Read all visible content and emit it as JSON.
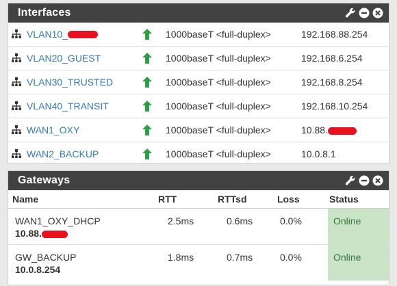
{
  "interfaces": {
    "title": "Interfaces",
    "rows": [
      {
        "name": "VLAN10_",
        "redacted": true,
        "media": "1000baseT <full-duplex>",
        "ip": "192.168.88.254"
      },
      {
        "name": "VLAN20_GUEST",
        "media": "1000baseT <full-duplex>",
        "ip": "192.168.6.254"
      },
      {
        "name": "VLAN30_TRUSTED",
        "media": "1000baseT <full-duplex>",
        "ip": "192.168.8.254"
      },
      {
        "name": "VLAN40_TRANSIT",
        "media": "1000baseT <full-duplex>",
        "ip": "192.168.10.254"
      },
      {
        "name": "WAN1_OXY",
        "media": "1000baseT <full-duplex>",
        "ip": "10.88.",
        "ip_redacted": true
      },
      {
        "name": "WAN2_BACKUP",
        "media": "1000baseT <full-duplex>",
        "ip": "10.0.8.1"
      }
    ]
  },
  "gateways": {
    "title": "Gateways",
    "headers": {
      "name": "Name",
      "rtt": "RTT",
      "rttsd": "RTTsd",
      "loss": "Loss",
      "status": "Status"
    },
    "rows": [
      {
        "name": "WAN1_OXY_DHCP",
        "ip": "10.88.",
        "ip_redacted": true,
        "rtt": "2.5ms",
        "rttsd": "0.6ms",
        "loss": "0.0%",
        "status": "Online"
      },
      {
        "name": "GW_BACKUP",
        "ip": "10.0.8.254",
        "rtt": "1.8ms",
        "rttsd": "0.7ms",
        "loss": "0.0%",
        "status": "Online"
      }
    ]
  },
  "icons": {
    "wrench": "wrench-icon",
    "minimize": "minus-circle-icon",
    "close": "close-circle-icon",
    "network": "network-icon",
    "status_up": "arrow-up-icon"
  },
  "colors": {
    "heading_bg": "#424242",
    "link": "#337ab7",
    "status_up": "#2e9e44",
    "online_bg": "#c9e4c6",
    "redaction": "#e8121e"
  }
}
